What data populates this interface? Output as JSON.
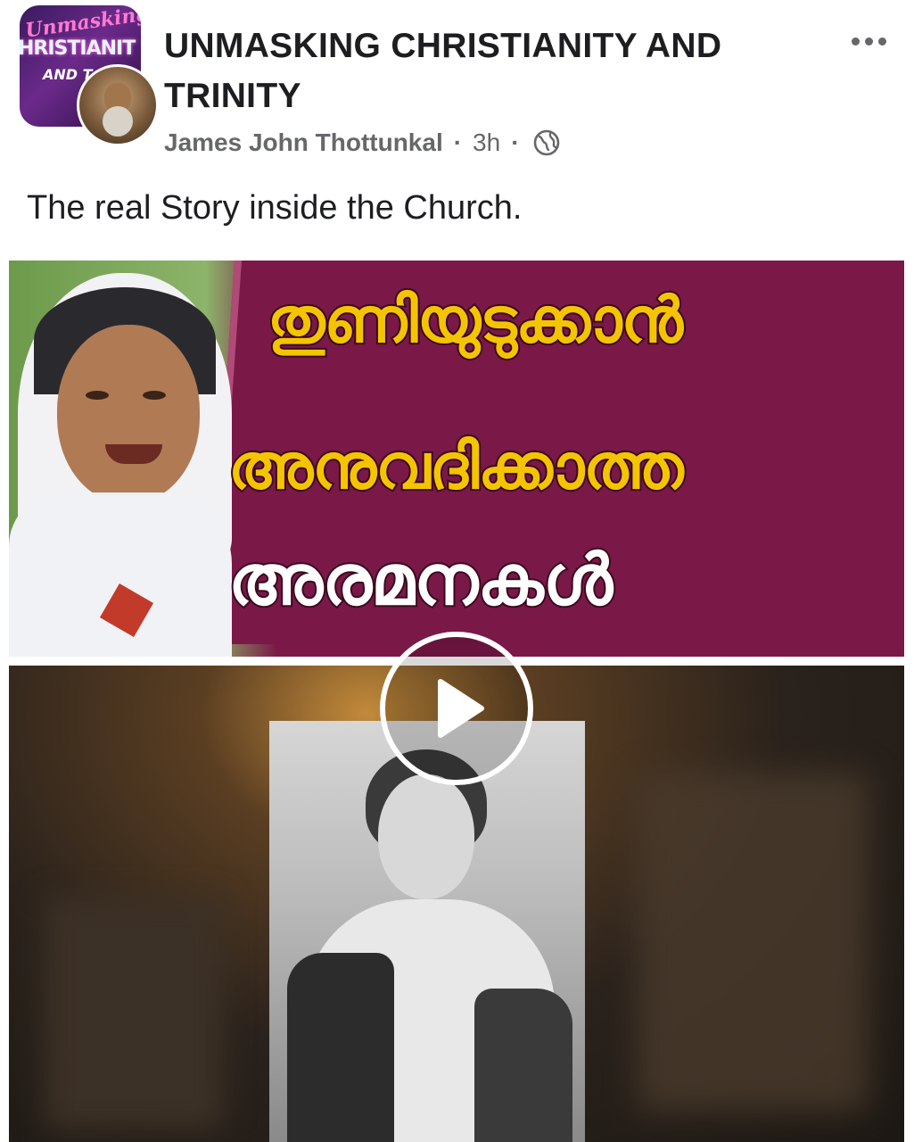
{
  "post": {
    "group_name": "UNMASKING CHRISTIANITY AND TRINITY",
    "author": "James John Thottunkal",
    "time": "3h",
    "separator": "·",
    "privacy_icon": "globe-icon",
    "caption": "The real Story inside the Church."
  },
  "group_avatar": {
    "line1": "Unmasking",
    "line2": "HRISTIANIT",
    "line3": "AND T"
  },
  "thumbnail": {
    "headline_line1": "തുണിയുടുക്കാൻ",
    "headline_line2": "അനുവദിക്കാത്ത",
    "headline_line3": "അരമനകൾ"
  },
  "icons": {
    "more": "more-options-icon",
    "play": "play-icon"
  },
  "colors": {
    "panel": "#7a1848",
    "headline_yellow": "#f5c400",
    "meta_gray": "#65676b"
  }
}
